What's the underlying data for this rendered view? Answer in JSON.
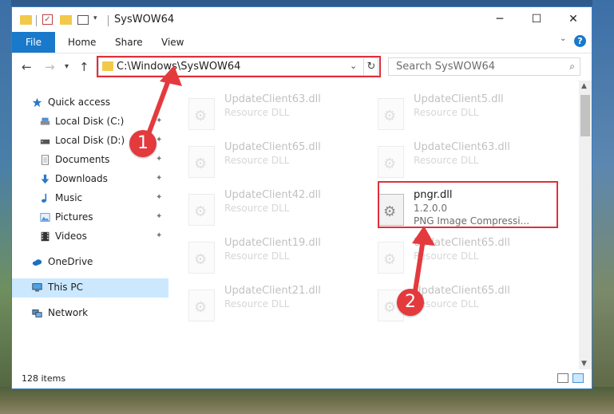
{
  "window": {
    "title": "SysWOW64",
    "controls": {
      "minimize": "─",
      "maximize": "☐",
      "close": "✕"
    }
  },
  "quick_access_toolbar": {
    "check_glyph": "✓",
    "dropdown_glyph": "▾"
  },
  "ribbon": {
    "file_tab": "File",
    "tabs": [
      "Home",
      "Share",
      "View"
    ],
    "expand_glyph": "⌄",
    "help_glyph": "?"
  },
  "navigation": {
    "back_glyph": "←",
    "forward_glyph": "→",
    "recent_glyph": "▾",
    "up_glyph": "↑",
    "address": "C:\\Windows\\SysWOW64",
    "address_dropdown_glyph": "⌄",
    "refresh_glyph": "↻",
    "search_placeholder": "Search SysWOW64",
    "search_glyph": "⌕"
  },
  "sidebar": {
    "items": [
      {
        "label": "Quick access",
        "icon": "star-icon"
      },
      {
        "label": "Local Disk (C:)",
        "icon": "drive-icon",
        "pinned": true
      },
      {
        "label": "Local Disk (D:)",
        "icon": "drive-icon",
        "pinned": true
      },
      {
        "label": "Documents",
        "icon": "documents-icon",
        "pinned": true
      },
      {
        "label": "Downloads",
        "icon": "download-icon",
        "pinned": true
      },
      {
        "label": "Music",
        "icon": "music-icon",
        "pinned": true
      },
      {
        "label": "Pictures",
        "icon": "pictures-icon",
        "pinned": true
      },
      {
        "label": "Videos",
        "icon": "videos-icon",
        "pinned": true
      },
      {
        "label": "OneDrive",
        "icon": "cloud-icon"
      },
      {
        "label": "This PC",
        "icon": "computer-icon",
        "selected": true
      },
      {
        "label": "Network",
        "icon": "network-icon"
      }
    ],
    "pin_glyph": "📌"
  },
  "files": {
    "left": [
      {
        "name": "UpdateClient63.dll",
        "type": "Resource DLL"
      },
      {
        "name": "UpdateClient65.dll",
        "type": "Resource DLL"
      },
      {
        "name": "UpdateClient42.dll",
        "type": "Resource DLL"
      },
      {
        "name": "UpdateClient19.dll",
        "type": "Resource DLL"
      },
      {
        "name": "UpdateClient21.dll",
        "type": "Resource DLL"
      }
    ],
    "right": [
      {
        "name": "UpdateClient5.dll",
        "type": "Resource DLL"
      },
      {
        "name": "UpdateClient63.dll",
        "type": "Resource DLL"
      },
      {
        "name": "pngr.dll",
        "version": "1.2.0.0",
        "type": "PNG Image Compressi..."
      },
      {
        "name": "UpdateClient65.dll",
        "type": "Resource DLL"
      },
      {
        "name": "UpdateClient65.dll",
        "type": "Resource DLL"
      }
    ]
  },
  "status": {
    "item_count": "128 items"
  },
  "callouts": [
    "1",
    "2"
  ],
  "colors": {
    "accent": "#1979ca",
    "highlight_box": "#e0303a",
    "callout": "#e33a3e",
    "selected_bg": "#cce8ff",
    "folder": "#f3c94b"
  }
}
